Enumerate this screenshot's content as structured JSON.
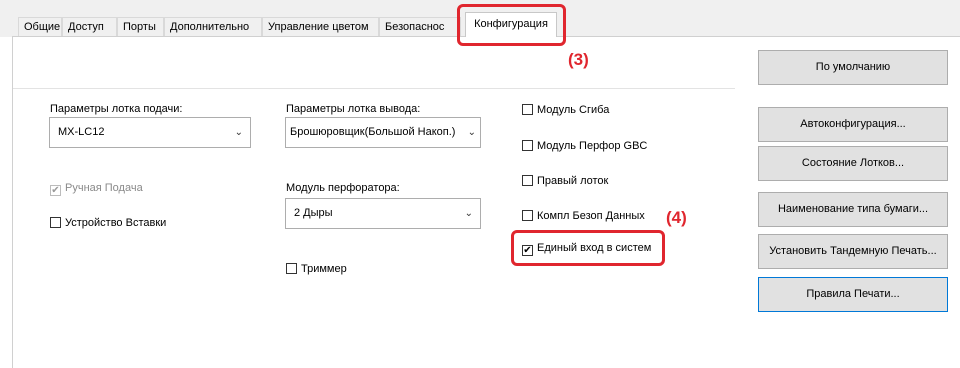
{
  "tabs": [
    {
      "label": "Общие"
    },
    {
      "label": "Доступ"
    },
    {
      "label": "Порты"
    },
    {
      "label": "Дополнительно"
    },
    {
      "label": "Управление цветом"
    },
    {
      "label": "Безопаснос"
    },
    {
      "label": "Конфигурация"
    }
  ],
  "paper_tray": {
    "label": "Параметры лотка подачи:",
    "value": "MX-LC12"
  },
  "output_tray": {
    "label": "Параметры лотка вывода:",
    "value": "Брошюровщик(Большой Накоп.)"
  },
  "punch": {
    "label": "Модуль перфоратора:",
    "value": "2 Дыры"
  },
  "checkboxes": {
    "manual_feed": {
      "label": "Ручная Подача",
      "checked": true,
      "disabled": true
    },
    "inserter": {
      "label": "Устройство Вставки",
      "checked": false
    },
    "trimmer": {
      "label": "Триммер",
      "checked": false
    },
    "folding_unit": {
      "label": "Модуль Сгиба",
      "checked": false
    },
    "gbc_punch": {
      "label": "Модуль Перфор GBC",
      "checked": false
    },
    "right_tray": {
      "label": "Правый лоток",
      "checked": false
    },
    "data_security": {
      "label": "Компл Безоп Данных",
      "checked": false
    },
    "single_signon": {
      "label": "Единый вход в систем",
      "checked": true
    }
  },
  "buttons": {
    "defaults": "По умолчанию",
    "auto_config": "Автоконфигурация...",
    "tray_status": "Состояние Лотков...",
    "paper_type_name": "Наименование типа бумаги...",
    "tandem_print": "Установить Тандемную Печать...",
    "print_rules": "Правила Печати..."
  },
  "callouts": {
    "step3": "(3)",
    "step4": "(4)"
  },
  "check_glyph": "✔",
  "arrow_glyph": "⌄",
  "accent_color": "#e0262e"
}
